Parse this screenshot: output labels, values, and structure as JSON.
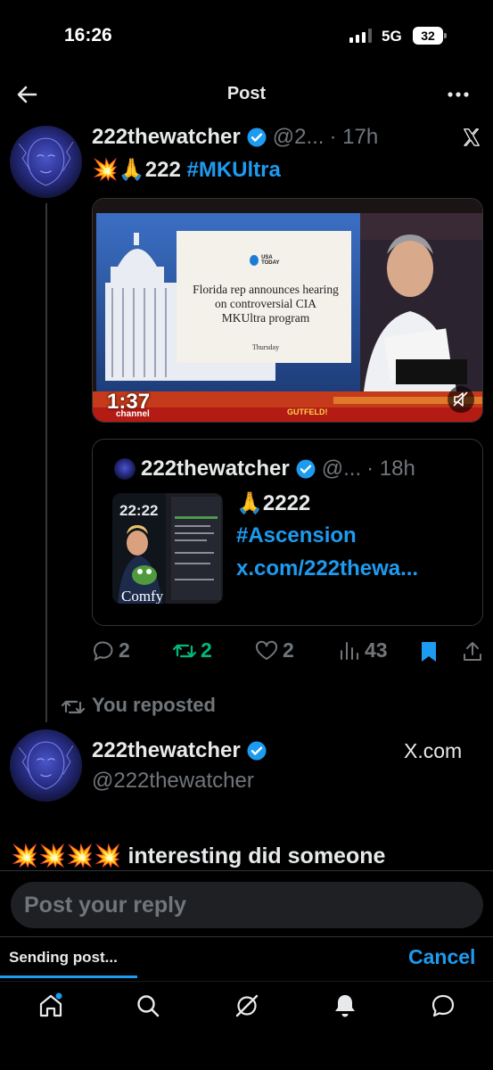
{
  "status_bar": {
    "time": "16:26",
    "network": "5G",
    "battery": "32"
  },
  "header": {
    "title": "Post"
  },
  "post": {
    "author_name": "222thewatcher",
    "author_handle": "@2...",
    "time": "· 17h",
    "source": "X",
    "text_prefix": "💥🙏222",
    "hashtag": "#MKUltra",
    "media": {
      "usa_today": "USA TODAY",
      "headline": "Florida rep announces hearing on controversial CIA MKUltra program",
      "day": "Thursday",
      "timer": "1:37",
      "channel": "channel",
      "show": "GUTFELD!"
    },
    "quote": {
      "author_name": "222thewatcher",
      "author_handle": "@...",
      "time": "· 18h",
      "thumb_time": "22:22",
      "thumb_caption": "Comfy",
      "line1": "🙏2222",
      "line2": "#Ascension",
      "line3": "x.com/222thewa..."
    },
    "actions": {
      "replies": "2",
      "reposts": "2",
      "likes": "2",
      "views": "43"
    }
  },
  "repost_note": "You reposted",
  "second_post": {
    "author_name": "222thewatcher",
    "author_handle": "@222thewatcher",
    "source": "X.com",
    "text_prefix": "💥💥💥💥",
    "text": "interesting did someone"
  },
  "reply": {
    "placeholder": "Post your reply"
  },
  "sending": {
    "label": "Sending post...",
    "cancel": "Cancel"
  },
  "colors": {
    "accent": "#1d9bf0",
    "repost_green": "#00ba7c",
    "muted": "#71767b"
  }
}
